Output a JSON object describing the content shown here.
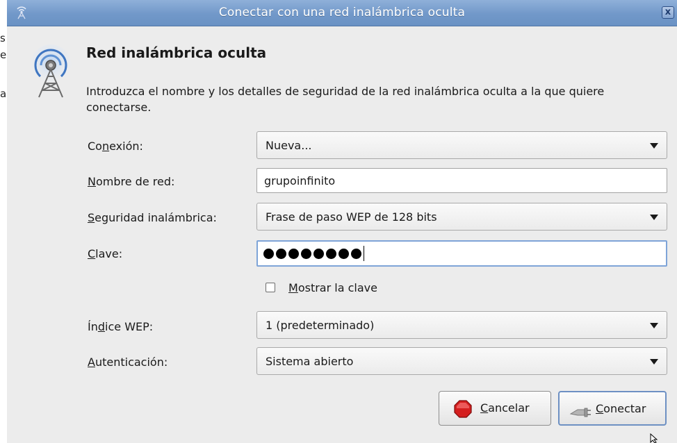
{
  "window": {
    "title": "Conectar con una red inalámbrica oculta",
    "close_glyph": "x"
  },
  "background_fragments": [
    "s",
    "e",
    "as"
  ],
  "header": {
    "heading": "Red inalámbrica oculta",
    "description": "Introduzca el nombre y los detalles de seguridad de la red inalámbrica oculta a la que quiere conectarse."
  },
  "form": {
    "connection": {
      "label_pre": "Co",
      "label_mn": "n",
      "label_post": "exión:",
      "value": "Nueva..."
    },
    "network_name": {
      "label_pre": "",
      "label_mn": "N",
      "label_post": "ombre de red:",
      "value": "grupoinfinito"
    },
    "security": {
      "label_pre": "",
      "label_mn": "S",
      "label_post": "eguridad inalámbrica:",
      "value": "Frase de paso WEP de 128 bits"
    },
    "key": {
      "label_pre": "",
      "label_mn": "C",
      "label_post": "lave:",
      "masked_length": 8
    },
    "show_key": {
      "label_pre": "",
      "label_mn": "M",
      "label_post": "ostrar la clave",
      "checked": false
    },
    "wep_index": {
      "label_pre": "Ín",
      "label_mn": "d",
      "label_post": "ice WEP:",
      "value": "1 (predeterminado)"
    },
    "authentication": {
      "label_pre": "",
      "label_mn": "A",
      "label_post": "utenticación:",
      "value": "Sistema abierto"
    }
  },
  "buttons": {
    "cancel": {
      "label_mn": "C",
      "label_post": "ancelar"
    },
    "connect": {
      "label_mn": "C",
      "label_post": "onectar"
    }
  },
  "icons": {
    "title": "wireless-icon",
    "header": "wireless-tower-icon",
    "cancel": "stop-icon",
    "connect": "plug-icon"
  },
  "colors": {
    "titlebar": "#7198c9",
    "focus_border": "#7ea4d8",
    "dialog_bg": "#ececec"
  }
}
